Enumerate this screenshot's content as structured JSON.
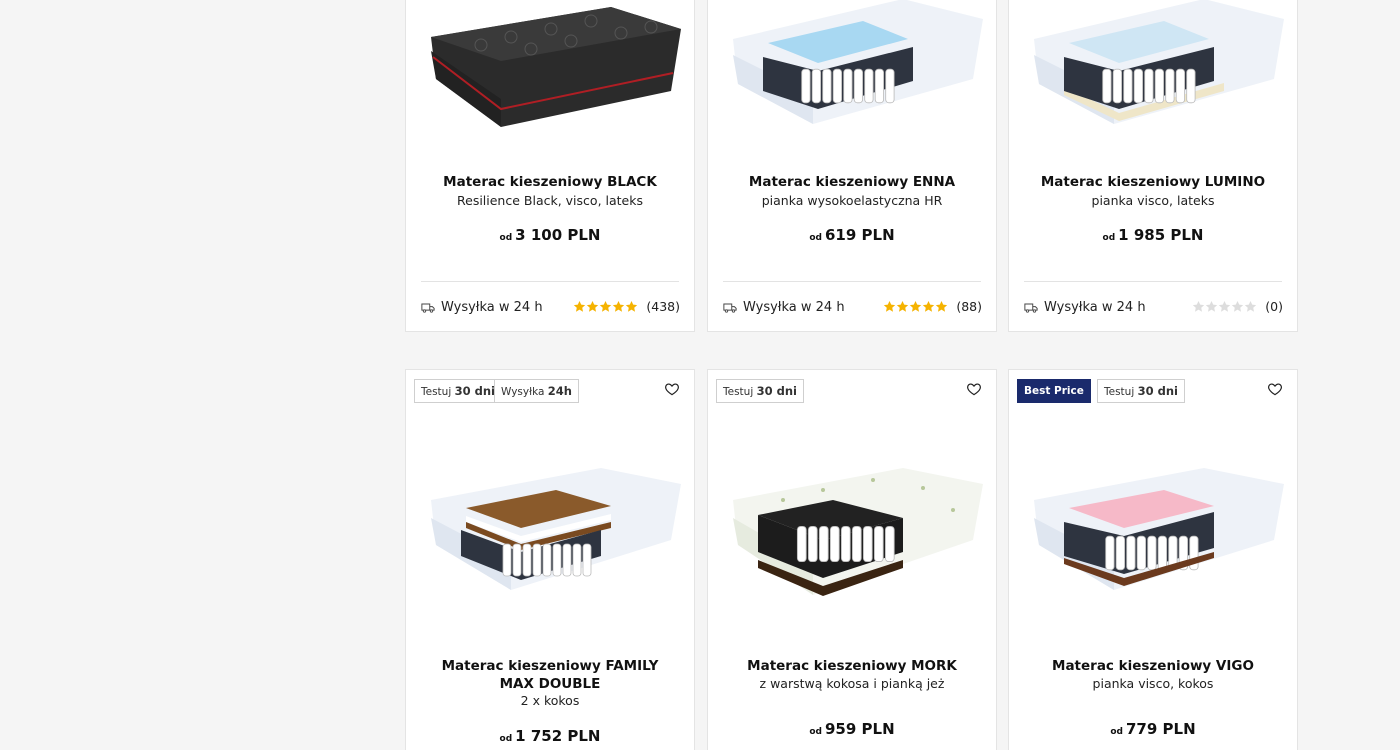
{
  "products": [
    {
      "title": "Materac kieszeniowy BLACK",
      "subtitle": "Resilience Black, visco, lateks",
      "price_prefix": "od",
      "price": "3 100 PLN",
      "shipping": "Wysyłka w 24 h",
      "rating_stars": 5,
      "reviews": "(438)",
      "image_icon": "black-mattress-image"
    },
    {
      "title": "Materac kieszeniowy ENNA",
      "subtitle": "pianka wysokoelastyczna HR",
      "price_prefix": "od",
      "price": "619 PLN",
      "shipping": "Wysyłka w 24 h",
      "rating_stars": 5,
      "reviews": "(88)",
      "image_icon": "enna-mattress-image"
    },
    {
      "title": "Materac kieszeniowy LUMINO",
      "subtitle": "pianka visco, lateks",
      "price_prefix": "od",
      "price": "1 985 PLN",
      "shipping": "Wysyłka w 24 h",
      "rating_stars": 0,
      "reviews": "(0)",
      "image_icon": "lumino-mattress-image"
    },
    {
      "badges": [
        {
          "pre": "Testuj",
          "strong": "30 dni"
        },
        {
          "pre": "Wysyłka",
          "strong": "24h"
        }
      ],
      "title": "Materac kieszeniowy FAMILY MAX DOUBLE",
      "subtitle": "2 x kokos",
      "price_prefix": "od",
      "price": "1 752 PLN",
      "image_icon": "family-max-double-mattress-image"
    },
    {
      "badges": [
        {
          "pre": "Testuj",
          "strong": "30 dni"
        }
      ],
      "title": "Materac kieszeniowy MORK",
      "subtitle": "z warstwą kokosa i pianką jeż",
      "price_prefix": "od",
      "price": "959 PLN",
      "image_icon": "mork-mattress-image"
    },
    {
      "badges": [
        {
          "label": "Best Price"
        },
        {
          "pre": "Testuj",
          "strong": "30 dni"
        }
      ],
      "title": "Materac kieszeniowy VIGO",
      "subtitle": "pianka visco, kokos",
      "price_prefix": "od",
      "price": "779 PLN",
      "image_icon": "vigo-mattress-image"
    }
  ],
  "colors": {
    "star": "#f5b301",
    "star_empty": "#dddddd",
    "best_price": "#1a2a6c"
  },
  "icons": {
    "shipping": "truck-icon",
    "wishlist": "heart-icon",
    "rating": "star-icon"
  }
}
